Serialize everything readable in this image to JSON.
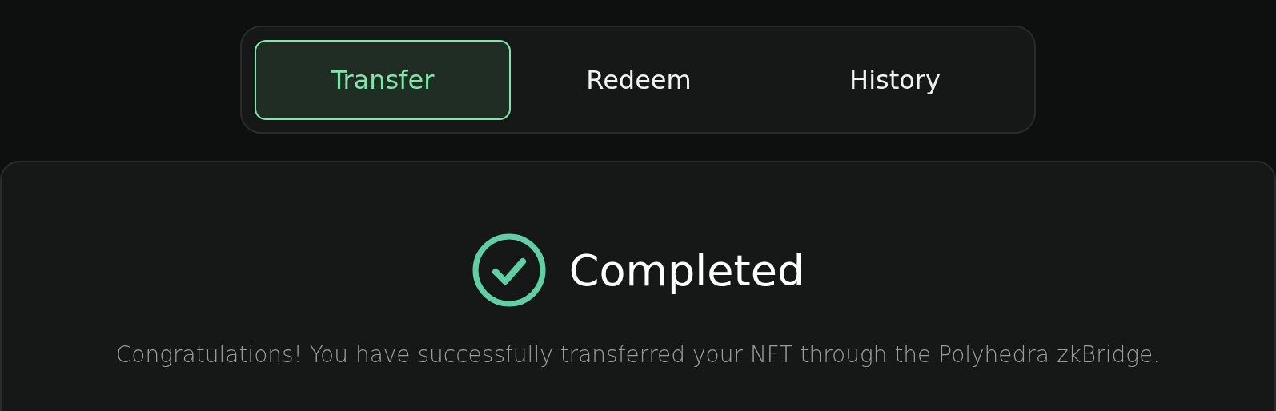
{
  "tabs": [
    {
      "label": "Transfer",
      "selected": true
    },
    {
      "label": "Redeem",
      "selected": false
    },
    {
      "label": "History",
      "selected": false
    }
  ],
  "status": {
    "kind": "success",
    "title": "Completed",
    "message": "Congratulations! You have successfully transferred your NFT through the Polyhedra zkBridge."
  }
}
